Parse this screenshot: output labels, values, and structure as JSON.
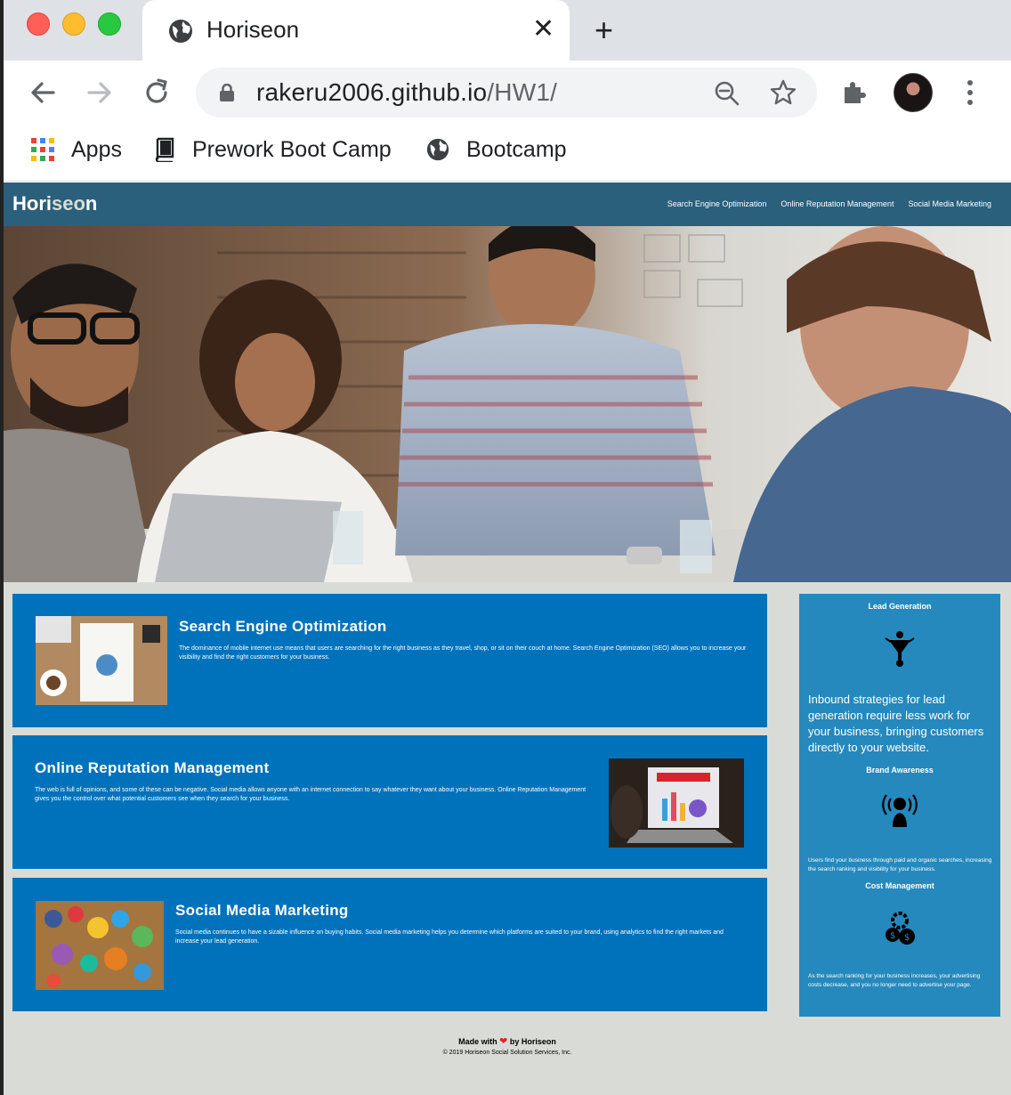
{
  "browser": {
    "tab_title": "Horiseon",
    "url_host": "rakeru2006.github.io",
    "url_path": "/HW1/",
    "bookmarks": [
      {
        "label": "Apps",
        "icon": "apps-grid-icon"
      },
      {
        "label": "Prework Boot Camp",
        "icon": "book-icon"
      },
      {
        "label": "Bootcamp",
        "icon": "globe-icon"
      }
    ]
  },
  "site": {
    "logo_main": "Hori",
    "logo_accent": "seo",
    "logo_end": "n",
    "nav": [
      "Search Engine Optimization",
      "Online Reputation Management",
      "Social Media Marketing"
    ]
  },
  "content": {
    "seo": {
      "title": "Search Engine Optimization",
      "text": "The dominance of mobile internet use means that users are searching for the right business as they travel, shop, or sit on their couch at home. Search Engine Optimization (SEO) allows you to increase your visibility and find the right customers for your business."
    },
    "orm": {
      "title": "Online Reputation Management",
      "text": "The web is full of opinions, and some of these can be negative. Social media allows anyone with an internet connection to say whatever they want about your business. Online Reputation Management gives you the control over what potential customers see when they search for your business."
    },
    "smm": {
      "title": "Social Media Marketing",
      "text": "Social media continues to have a sizable influence on buying habits. Social media marketing helps you determine which platforms are suited to your brand, using analytics to find the right markets and increase your lead generation."
    }
  },
  "benefits": {
    "lead": {
      "title": "Lead Generation",
      "text": "Inbound strategies for lead generation require less work for your business, bringing customers directly to your website."
    },
    "brand": {
      "title": "Brand Awareness",
      "text": "Users find your business through paid and organic searches, increasing the search ranking and visibility for your business."
    },
    "cost": {
      "title": "Cost Management",
      "text": "As the search ranking for your business increases, your advertising costs decrease, and you no longer need to advertise your page."
    }
  },
  "footer": {
    "made_prefix": "Made with",
    "made_suffix": "by Horiseon",
    "copyright": "© 2019 Horiseon Social Solution Services, Inc."
  },
  "colors": {
    "header_bg": "#2a607c",
    "card_bg": "#0072bb",
    "benefits_bg": "#2589bd",
    "page_bg": "#d9dcd6"
  }
}
